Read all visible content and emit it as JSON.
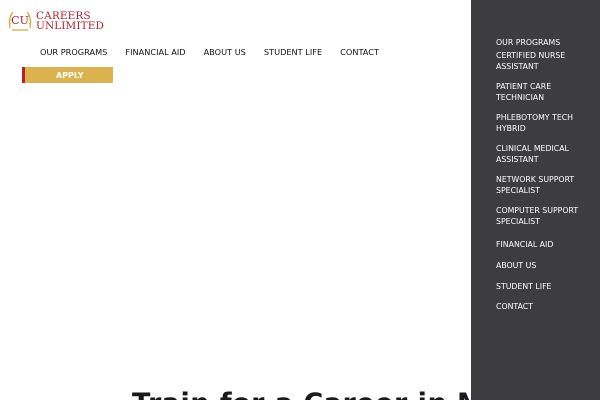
{
  "logo": {
    "initials": "CU",
    "line1": "CAREERS",
    "line2": "UNLIMITED"
  },
  "nav": {
    "items": [
      {
        "label": "OUR PROGRAMS"
      },
      {
        "label": "FINANCIAL AID"
      },
      {
        "label": "ABOUT US"
      },
      {
        "label": "STUDENT LIFE"
      },
      {
        "label": "CONTACT"
      }
    ]
  },
  "apply": {
    "label": "APPLY"
  },
  "hero": {
    "heading": "Train for a Career in Medical"
  },
  "side_menu": {
    "items": [
      {
        "label": "OUR PROGRAMS"
      },
      {
        "label": "CERTIFIED NURSE ASSISTANT"
      },
      {
        "label": "PATIENT CARE TECHNICIAN"
      },
      {
        "label": "PHLEBOTOMY TECH HYBRID"
      },
      {
        "label": "CLINICAL MEDICAL ASSISTANT"
      },
      {
        "label": "NETWORK SUPPORT SPECIALIST"
      },
      {
        "label": "COMPUTER SUPPORT SPECIALIST"
      },
      {
        "label": "FINANCIAL AID"
      },
      {
        "label": "ABOUT US"
      },
      {
        "label": "STUDENT LIFE"
      },
      {
        "label": "CONTACT"
      }
    ]
  },
  "colors": {
    "brand_red": "#b71e2e",
    "brand_gold": "#dcb24e",
    "side_panel_bg": "#3d3d40"
  }
}
